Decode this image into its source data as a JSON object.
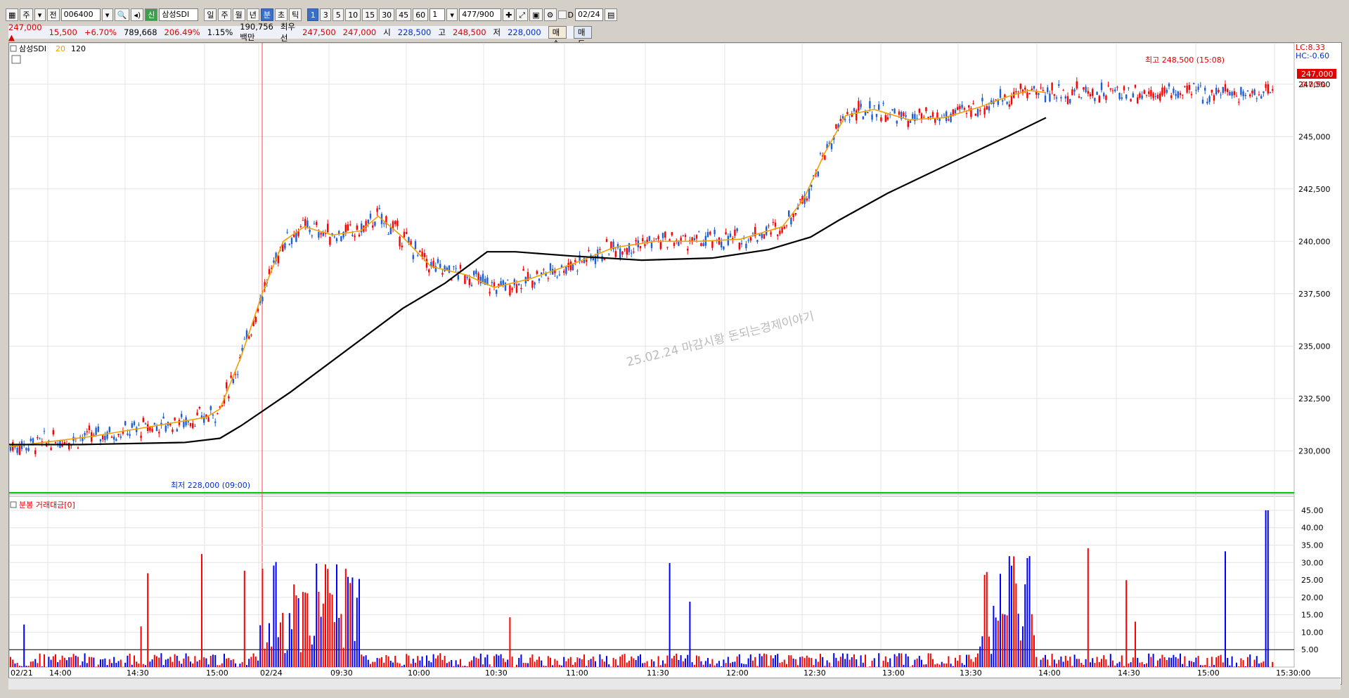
{
  "toolbar": {
    "code": "006400",
    "name_badge": "신",
    "name": "삼성SDI",
    "period_buttons": [
      "일",
      "주",
      "월",
      "년",
      "분",
      "초",
      "틱"
    ],
    "interval_buttons": [
      "1",
      "3",
      "5",
      "10",
      "15",
      "30",
      "45",
      "60"
    ],
    "count_select": "1",
    "range": "477/900",
    "mode_a": "주",
    "mode_b": "전",
    "date_label": "D",
    "date_value": "02/24"
  },
  "quote": {
    "price": "247,000",
    "arrow": "▲",
    "change": "15,500",
    "change_pct": "+6.70%",
    "volume": "789,668",
    "volume_pct": "206.49%",
    "turnover_pct": "1.15%",
    "amount": "190,756백만",
    "best_label": "최우선",
    "best_ask": "247,500",
    "best_bid": "247,000",
    "open_label": "시",
    "open": "228,500",
    "high_label": "고",
    "high": "248,500",
    "low_label": "저",
    "low": "228,000",
    "buy_button": "매수",
    "sell_button": "매도"
  },
  "price_panel": {
    "legend_name": "삼성SDI",
    "legend_ma20": "20",
    "legend_ma120": "120",
    "lc": "LC:8.33",
    "hc": "HC:-0.60",
    "current_price": "247,000",
    "current_pct": "0.00%",
    "high_note": "최고 248,500 (15:08)",
    "low_note": "최저 228,000 (09:00)",
    "watermark": "25.02.24 마감시황 돈되는경제이야기"
  },
  "volume_panel": {
    "legend": "분봉 거래대금[0]"
  },
  "colors": {
    "up": "#ff0000",
    "down": "#1f5fd6",
    "ma20": "#f0a000",
    "ma120": "#000000",
    "low_line": "#00cc00",
    "vol_up": "#ff0000",
    "vol_down": "#0000ff"
  },
  "chart_data": [
    {
      "type": "candlestick",
      "title": "삼성SDI 1분봉",
      "y_ticks": [
        230000,
        232500,
        235000,
        237500,
        240000,
        242500,
        245000,
        247500
      ],
      "y_tick_labels": [
        "230,000",
        "232,500",
        "235,000",
        "237,500",
        "240,000",
        "242,500",
        "245,000",
        "247,500"
      ],
      "ylim": [
        228000,
        248800
      ],
      "x_labels": [
        "02/21",
        "14:00",
        "14:30",
        "15:00",
        "02/24",
        "09:30",
        "10:00",
        "10:30",
        "11:00",
        "11:30",
        "12:00",
        "12:30",
        "13:00",
        "13:30",
        "14:00",
        "14:30",
        "15:00",
        "15:30:00"
      ],
      "series": [
        {
          "name": "20",
          "description_points": [
            [
              0,
              230200
            ],
            [
              120,
              230700
            ],
            [
              280,
              231600
            ],
            [
              300,
              232000
            ],
            [
              330,
              234500
            ],
            [
              360,
              237500
            ],
            [
              390,
              240000
            ],
            [
              420,
              240700
            ],
            [
              460,
              240300
            ],
            [
              500,
              240500
            ],
            [
              525,
              241200
            ],
            [
              560,
              240200
            ],
            [
              600,
              238800
            ],
            [
              650,
              238400
            ],
            [
              690,
              237800
            ],
            [
              740,
              238200
            ],
            [
              800,
              238900
            ],
            [
              860,
              239700
            ],
            [
              920,
              240000
            ],
            [
              980,
              240000
            ],
            [
              1040,
              240100
            ],
            [
              1100,
              240700
            ],
            [
              1130,
              242000
            ],
            [
              1160,
              244200
            ],
            [
              1190,
              246000
            ],
            [
              1230,
              246300
            ],
            [
              1280,
              245800
            ],
            [
              1330,
              245900
            ],
            [
              1380,
              246400
            ],
            [
              1420,
              246900
            ],
            [
              1450,
              247200
            ],
            [
              1475,
              247100
            ]
          ]
        },
        {
          "name": "120",
          "description_points": [
            [
              0,
              230300
            ],
            [
              100,
              230300
            ],
            [
              250,
              230400
            ],
            [
              300,
              230600
            ],
            [
              330,
              231200
            ],
            [
              400,
              232800
            ],
            [
              500,
              235300
            ],
            [
              560,
              236800
            ],
            [
              620,
              238000
            ],
            [
              680,
              239500
            ],
            [
              720,
              239500
            ],
            [
              800,
              239300
            ],
            [
              900,
              239100
            ],
            [
              1000,
              239200
            ],
            [
              1080,
              239600
            ],
            [
              1140,
              240200
            ],
            [
              1180,
              241000
            ],
            [
              1250,
              242300
            ],
            [
              1350,
              243900
            ],
            [
              1420,
              245000
            ],
            [
              1475,
              245900
            ]
          ]
        }
      ],
      "high": 248500,
      "low": 228000,
      "last": 247000
    },
    {
      "type": "bar",
      "title": "분봉 거래대금[0]",
      "y_ticks": [
        5,
        10,
        15,
        20,
        25,
        30,
        35,
        40,
        45
      ],
      "y_tick_labels": [
        "5.00",
        "10.00",
        "15.00",
        "20.00",
        "25.00",
        "30.00",
        "35.00",
        "40.00",
        "45.00"
      ],
      "ylim": [
        0,
        46
      ],
      "reference_line": 5
    }
  ]
}
